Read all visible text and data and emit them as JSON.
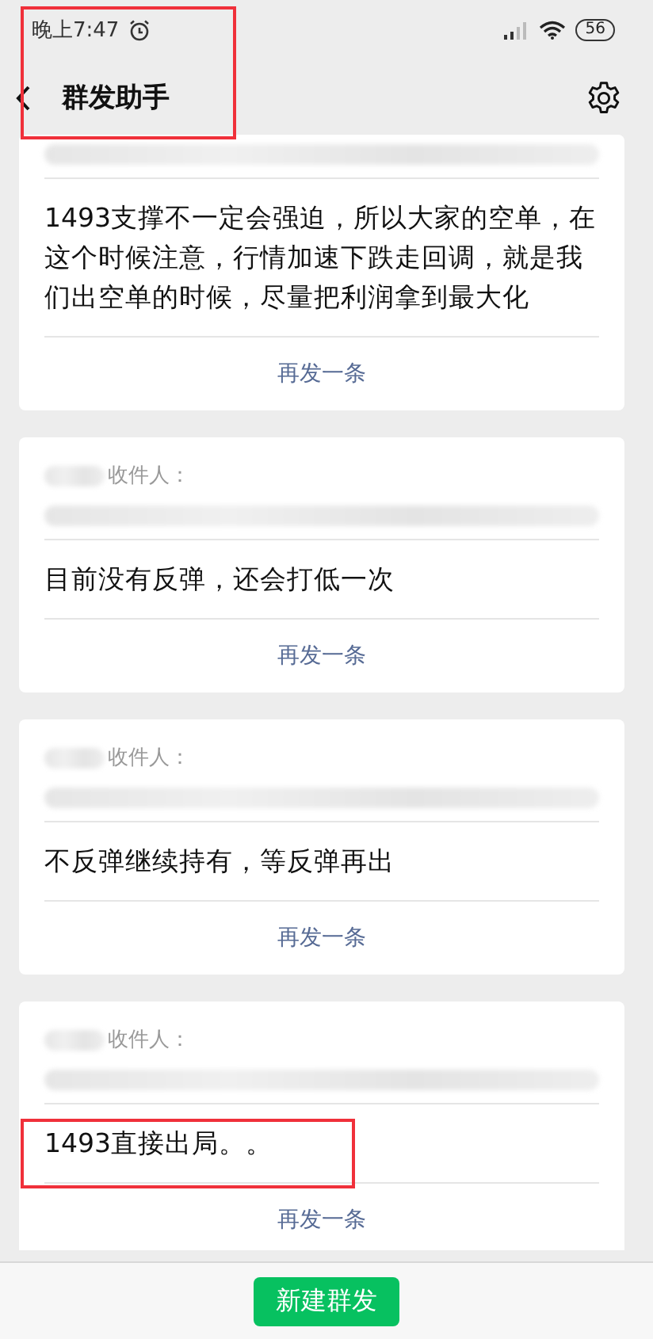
{
  "status_bar": {
    "time": "晚上7:47",
    "battery": "56"
  },
  "header": {
    "title": "群发助手"
  },
  "cards": [
    {
      "message": "1493支撑不一定会强迫，所以大家的空单，在这个时候注意，行情加速下跌走回调，就是我们出空单的时候，尽量把利润拿到最大化",
      "resend": "再发一条"
    },
    {
      "recipient_label": "收件人：",
      "message": "目前没有反弹，还会打低一次",
      "resend": "再发一条"
    },
    {
      "recipient_label": "收件人：",
      "message": "不反弹继续持有，等反弹再出",
      "resend": "再发一条"
    },
    {
      "recipient_label": "收件人：",
      "message": "1493直接出局。。",
      "resend": "再发一条"
    }
  ],
  "bottom_bar": {
    "button": "新建群发"
  }
}
